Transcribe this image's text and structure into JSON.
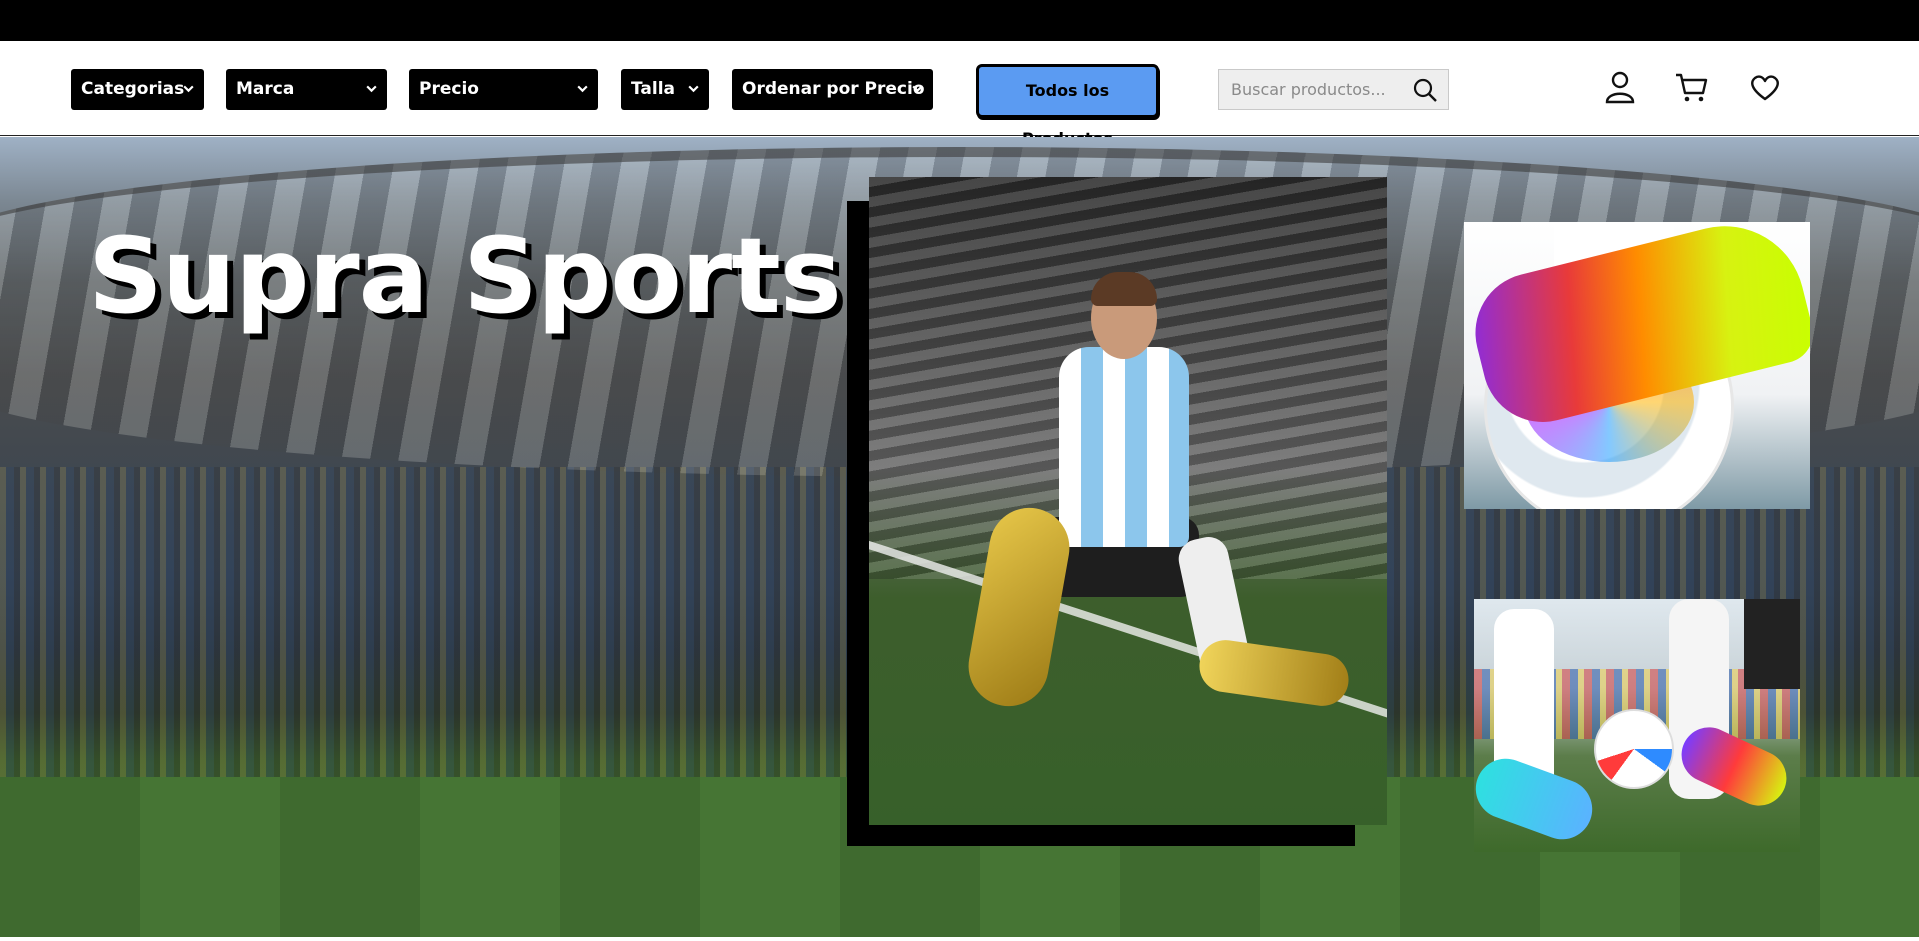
{
  "filters": [
    {
      "label": "Categorias"
    },
    {
      "label": "Marca"
    },
    {
      "label": "Precio"
    },
    {
      "label": "Talla"
    },
    {
      "label": "Ordenar por Precio"
    }
  ],
  "all_products_button": {
    "label": "Todos los Productos",
    "color": "#5b9bf2"
  },
  "search": {
    "placeholder": "Buscar productos...",
    "value": "",
    "icon": "search-icon"
  },
  "header_icons": [
    "user-icon",
    "cart-icon",
    "heart-icon"
  ],
  "hero": {
    "title": "Supra Sports",
    "images": [
      "player-photo",
      "boot-on-ball-photo",
      "boots-and-ball-photo"
    ]
  },
  "colors": {
    "topbar": "#000000",
    "filter_bg": "#000000",
    "filter_text": "#ffffff",
    "accent": "#5b9bf2"
  }
}
